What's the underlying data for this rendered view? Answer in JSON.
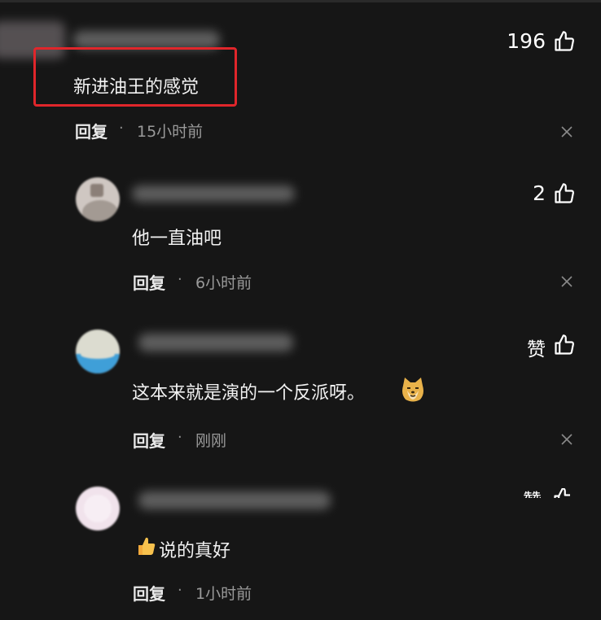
{
  "comments": [
    {
      "text": "新进油王的感觉",
      "likes": "196",
      "reply_label": "回复",
      "separator": "·",
      "time": "15小时前"
    },
    {
      "text": "他一直油吧",
      "likes": "2",
      "reply_label": "回复",
      "separator": "·",
      "time": "6小时前"
    },
    {
      "text": "这本来就是演的一个反派呀。",
      "likes": "赞",
      "reply_label": "回复",
      "separator": "·",
      "time": "刚刚"
    },
    {
      "text": "说的真好",
      "likes": "赞",
      "reply_label": "回复",
      "separator": "·",
      "time": "1小时前"
    }
  ],
  "colors": {
    "background": "#161616",
    "highlight_border": "#e0262b",
    "text": "#f2f2f2",
    "muted": "#9a9a9a"
  },
  "icons": [
    "thumbs-up-icon",
    "close-icon",
    "doge-emoji-icon",
    "thumbs-up-emoji-icon"
  ]
}
